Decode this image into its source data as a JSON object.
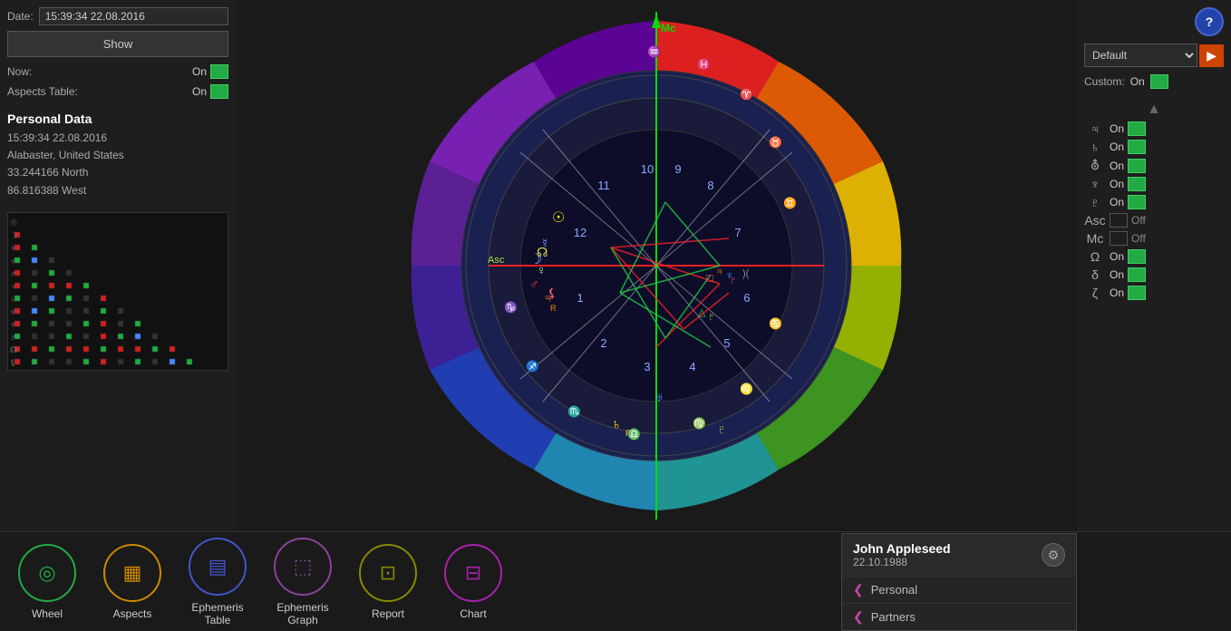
{
  "header": {
    "date_label": "Date:",
    "date_value": "15:39:34 22.08.2016",
    "show_button": "Show"
  },
  "toggles": {
    "now_label": "Now:",
    "now_value": "On",
    "aspects_table_label": "Aspects Table:",
    "aspects_table_value": "On"
  },
  "personal_data": {
    "title": "Personal Data",
    "datetime": "15:39:34 22.08.2016",
    "location": "Alabaster, United States",
    "lat": "33.244166 North",
    "lon": "86.816388 West"
  },
  "right_panel": {
    "default_label": "Default",
    "custom_label": "Custom:",
    "custom_value": "On",
    "help_label": "?"
  },
  "planets": [
    {
      "symbol": "♃",
      "name": "Jupiter",
      "status": "On",
      "id": "jupiter"
    },
    {
      "symbol": "♄",
      "name": "Saturn",
      "status": "On",
      "id": "saturn"
    },
    {
      "symbol": "⛢",
      "name": "Uranus",
      "status": "On",
      "id": "uranus"
    },
    {
      "symbol": "♆",
      "name": "Neptune",
      "status": "On",
      "id": "neptune"
    },
    {
      "symbol": "♇",
      "name": "Pluto",
      "status": "On",
      "id": "pluto"
    },
    {
      "symbol": "Asc",
      "name": "Ascendant",
      "status": "Off",
      "id": "asc"
    },
    {
      "symbol": "Mc",
      "name": "Midheaven",
      "status": "Off",
      "id": "mc"
    },
    {
      "symbol": "Ω",
      "name": "Node",
      "status": "On",
      "id": "node"
    },
    {
      "symbol": "δ",
      "name": "Lilith",
      "status": "On",
      "id": "lilith"
    },
    {
      "symbol": "ζ",
      "name": "Chiron",
      "status": "On",
      "id": "chiron"
    }
  ],
  "right_panel_top": [
    {
      "label": "On",
      "id": "top1"
    },
    {
      "label": "On",
      "id": "top2"
    },
    {
      "label": "On",
      "id": "top3"
    },
    {
      "label": "On",
      "id": "top4"
    },
    {
      "label": "On",
      "id": "top5"
    },
    {
      "label": "On",
      "id": "top6"
    }
  ],
  "nav_items": [
    {
      "id": "wheel",
      "label": "Wheel",
      "color": "#22aa44",
      "icon": "⊙",
      "border": "#22aa44"
    },
    {
      "id": "aspects",
      "label": "Aspects",
      "color": "#cc8800",
      "icon": "▦",
      "border": "#cc8800"
    },
    {
      "id": "ephemeris-table",
      "label": "Ephemeris\nTable",
      "color": "#4455cc",
      "icon": "▤",
      "border": "#4455cc"
    },
    {
      "id": "ephemeris-graph",
      "label": "Ephemeris\nGraph",
      "color": "#884499",
      "icon": "📈",
      "border": "#884499"
    },
    {
      "id": "report",
      "label": "Report",
      "color": "#888800",
      "icon": "⊡",
      "border": "#888800"
    },
    {
      "id": "chart",
      "label": "Chart",
      "color": "#aa22aa",
      "icon": "⊟",
      "border": "#aa22aa"
    }
  ],
  "profile": {
    "name": "John Appleseed",
    "date": "22.10.1988",
    "personal_label": "Personal",
    "partners_label": "Partners"
  },
  "wheel": {
    "mc_label": "Mc",
    "asc_label": "Asc",
    "house_numbers": [
      "1",
      "2",
      "3",
      "4",
      "5",
      "6",
      "7",
      "8",
      "9",
      "10",
      "11",
      "12"
    ]
  }
}
